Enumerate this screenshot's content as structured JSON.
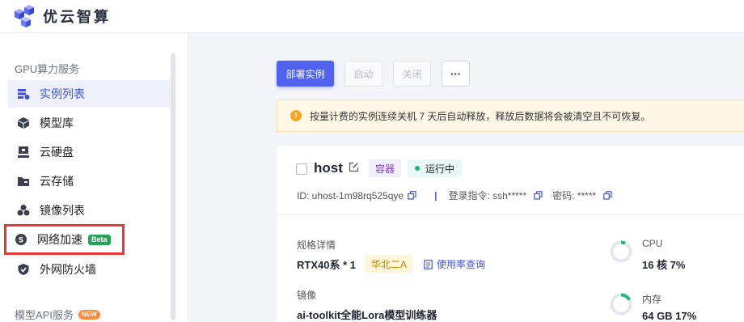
{
  "header": {
    "brand": "优云智算",
    "logo": "cube-logo-icon"
  },
  "sidebar": {
    "section1": "GPU算力服务",
    "items": [
      {
        "label": "实例列表",
        "icon": "instances-icon",
        "active": true
      },
      {
        "label": "模型库",
        "icon": "model-box-icon"
      },
      {
        "label": "云硬盘",
        "icon": "cloud-disk-icon"
      },
      {
        "label": "云存储",
        "icon": "folder-icon"
      },
      {
        "label": "镜像列表",
        "icon": "image-list-icon"
      },
      {
        "label": "网络加速",
        "icon": "network-accel-icon",
        "badge": "Beta"
      },
      {
        "label": "外网防火墙",
        "icon": "shield-icon"
      }
    ],
    "section2": "模型API服务",
    "section2_badge": "NEW"
  },
  "toolbar": {
    "deploy": "部署实例",
    "start": "启动",
    "stop": "关闭",
    "more": "···"
  },
  "notice": {
    "text": "按量计费的实例连续关机 7 天后自动释放，释放后数据将会被清空且不可恢复。"
  },
  "instance": {
    "name": "host",
    "type_tag": "容器",
    "status": "运行中",
    "id_label": "ID: uhost-1m98rq525qye",
    "login_label": "登录指令: ssh*****",
    "password_label": "密码: *****",
    "spec_label": "规格详情",
    "spec_value": "RTX40系 * 1",
    "region": "华北二A",
    "usage_link": "使用率查询",
    "image_label": "镜像",
    "image_value": "ai-toolkit全能Lora模型训练器",
    "cpu_label": "CPU",
    "cpu_value": "16 核 7%",
    "cpu_percent": 7,
    "mem_label": "内存",
    "mem_value": "64 GB 17%",
    "mem_percent": 17
  },
  "colors": {
    "primary": "#4f62f0",
    "highlight_border": "#e53935",
    "ring_track": "#e3e6ee",
    "ring_fill": "#22b573"
  }
}
